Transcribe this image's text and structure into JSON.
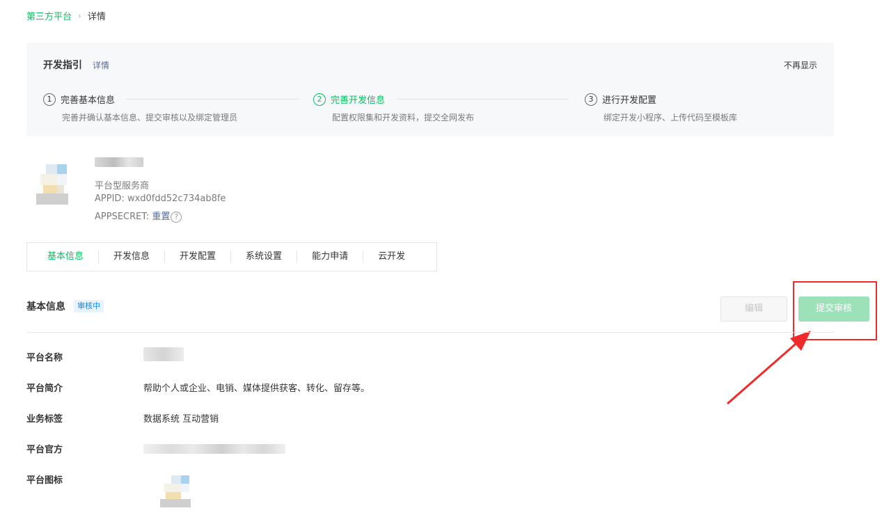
{
  "breadcrumb": {
    "parent": "第三方平台",
    "separator": "›",
    "current": "详情"
  },
  "guide": {
    "title": "开发指引",
    "detail_link": "详情",
    "hide_link": "不再显示",
    "steps": [
      {
        "num": "1",
        "title": "完善基本信息",
        "desc": "完善并确认基本信息、提交审核以及绑定管理员"
      },
      {
        "num": "2",
        "title": "完善开发信息",
        "desc": "配置权限集和开发资料，提交全网发布"
      },
      {
        "num": "3",
        "title": "进行开发配置",
        "desc": "绑定开发小程序、上传代码至模板库"
      }
    ]
  },
  "account": {
    "type": "平台型服务商",
    "appid_label": "APPID:",
    "appid_value": "wxd0fdd52c734ab8fe",
    "secret_label": "APPSECRET:",
    "secret_reset": "重置",
    "help_glyph": "?"
  },
  "tabs": [
    "基本信息",
    "开发信息",
    "开发配置",
    "系统设置",
    "能力申请",
    "云开发"
  ],
  "section": {
    "title": "基本信息",
    "status_badge": "审核中",
    "edit_button": "编辑",
    "submit_button": "提交审核"
  },
  "info": {
    "name_label": "平台名称",
    "intro_label": "平台简介",
    "intro_value": "帮助个人或企业、电销、媒体提供获客、转化、留存等。",
    "tags_label": "业务标签",
    "tags_value": "数据系统 互动营销",
    "site_label": "平台官方",
    "icon_label": "平台图标"
  },
  "colors": {
    "brand": "#07c160",
    "link": "#576b95",
    "annotation": "#ee2a2a",
    "badge": "#1485ee"
  }
}
